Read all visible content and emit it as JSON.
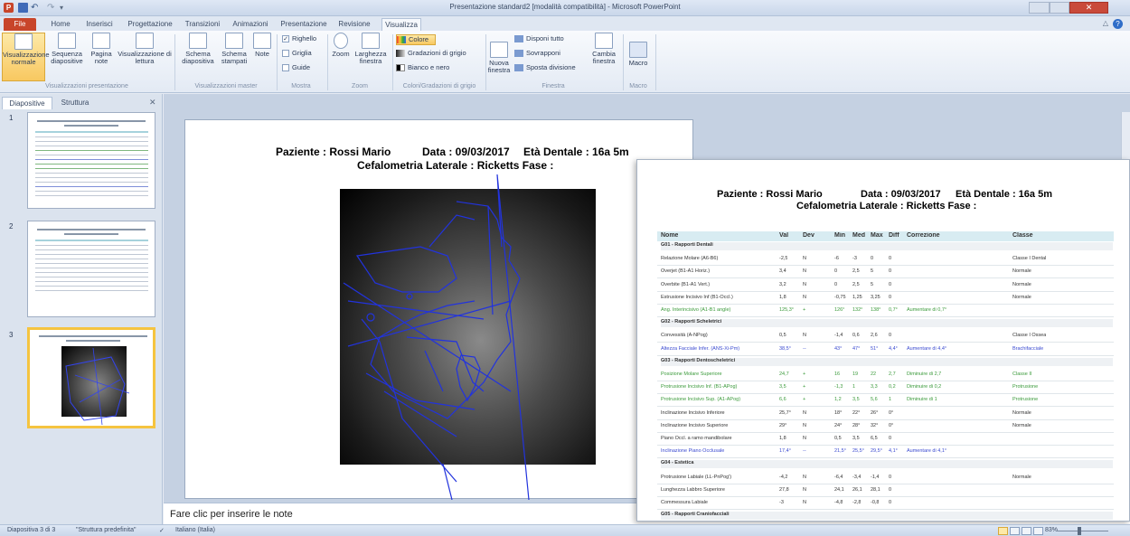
{
  "window": {
    "title": "Presentazione standard2 [modalità compatibilità] - Microsoft PowerPoint"
  },
  "tabs": [
    "File",
    "Home",
    "Inserisci",
    "Progettazione",
    "Transizioni",
    "Animazioni",
    "Presentazione",
    "Revisione",
    "Visualizza"
  ],
  "ribbon": {
    "views": {
      "normal": "Visualizzazione normale",
      "sorter": "Sequenza diapositive",
      "notes": "Pagina note",
      "reading": "Visualizzazione di lettura",
      "group": "Visualizzazioni presentazione"
    },
    "master": {
      "slide": "Schema diapositiva",
      "handout": "Schema stampati",
      "notes": "Note",
      "group": "Visualizzazioni master"
    },
    "show": {
      "ruler": "Righello",
      "grid": "Griglia",
      "guides": "Guide",
      "group": "Mostra"
    },
    "zoom": {
      "zoom": "Zoom",
      "fit": "Larghezza finestra",
      "group": "Zoom"
    },
    "color": {
      "color": "Colore",
      "gray": "Gradazioni di grigio",
      "bw": "Bianco e nero",
      "group": "Colori/Gradazioni di grigio"
    },
    "window": {
      "new": "Nuova finestra",
      "arrange": "Disponi tutto",
      "cascade": "Sovrapponi",
      "split": "Sposta divisione",
      "switch": "Cambia finestra",
      "group": "Finestra"
    },
    "macro": {
      "macro": "Macro",
      "group": "Macro"
    }
  },
  "panel": {
    "tab_slides": "Diapositive",
    "tab_outline": "Struttura",
    "slide_numbers": [
      "1",
      "2",
      "3"
    ]
  },
  "slide": {
    "patient": "Paziente : Rossi Mario",
    "date": "Data : 09/03/2017",
    "age": "Età Dentale : 16a 5m",
    "subtitle": "Cefalometria Laterale : Ricketts  Fase :"
  },
  "notes_placeholder": "Fare clic per inserire le note",
  "report": {
    "headers": [
      "Nome",
      "Val",
      "Dev",
      "Min",
      "Med",
      "Max",
      "Diff",
      "Correzione",
      "Classe"
    ],
    "rows": [
      {
        "type": "section",
        "cells": [
          "G01 - Rapporti Dentali"
        ]
      },
      {
        "type": "row",
        "color": "#333333",
        "cells": [
          "Relazione Molare (A6-B6)",
          "-2,5",
          "N",
          "-6",
          "-3",
          "0",
          "0",
          "",
          "Classe I Dental"
        ]
      },
      {
        "type": "row",
        "color": "#333333",
        "cells": [
          "Overjet (B1-A1 Horiz.)",
          "3,4",
          "N",
          "0",
          "2,5",
          "5",
          "0",
          "",
          "Normale"
        ]
      },
      {
        "type": "row",
        "color": "#333333",
        "cells": [
          "Overbite (B1-A1 Vert.)",
          "3,2",
          "N",
          "0",
          "2,5",
          "5",
          "0",
          "",
          "Normale"
        ]
      },
      {
        "type": "row",
        "color": "#333333",
        "cells": [
          "Estrusione Incisivo Inf (B1-Occl.)",
          "1,8",
          "N",
          "-0,75",
          "1,25",
          "3,25",
          "0",
          "",
          "Normale"
        ]
      },
      {
        "type": "row",
        "color": "#3a9a3a",
        "cells": [
          "Ang. Interincisivo (A1-B1 angle)",
          "125,3°",
          "+",
          "126°",
          "132°",
          "138°",
          "0,7°",
          "Aumentare di 0,7°",
          ""
        ]
      },
      {
        "type": "section",
        "cells": [
          "G02 - Rapporti Scheletrici"
        ]
      },
      {
        "type": "row",
        "color": "#333333",
        "cells": [
          "Convessità (A-NPog)",
          "0,5",
          "N",
          "-1,4",
          "0,6",
          "2,6",
          "0",
          "",
          "Classe I Ossea"
        ]
      },
      {
        "type": "row",
        "color": "#3a4ad0",
        "cells": [
          "Altezza Facciale Infer. (ANS-Xi-Pm)",
          "38,5°",
          "--",
          "43°",
          "47°",
          "51°",
          "4,4°",
          "Aumentare di 4,4°",
          "Brachifacciale"
        ]
      },
      {
        "type": "section",
        "cells": [
          "G03 - Rapporti Dentoscheletrici"
        ]
      },
      {
        "type": "row",
        "color": "#3a9a3a",
        "cells": [
          "Posizione Molare Superiore",
          "24,7",
          "+",
          "16",
          "19",
          "22",
          "2,7",
          "Diminuire di 2,7",
          "Classe II"
        ]
      },
      {
        "type": "row",
        "color": "#3a9a3a",
        "cells": [
          "Protrusione Incisivo Inf. (B1-APog)",
          "3,5",
          "+",
          "-1,3",
          "1",
          "3,3",
          "0,2",
          "Diminuire di 0,2",
          "Protrusione"
        ]
      },
      {
        "type": "row",
        "color": "#3a9a3a",
        "cells": [
          "Protrusione Incisivo Sup. (A1-APog)",
          "6,6",
          "+",
          "1,2",
          "3,5",
          "5,6",
          "1",
          "Diminuire di 1",
          "Protrusione"
        ]
      },
      {
        "type": "row",
        "color": "#333333",
        "cells": [
          "Inclinazione Incisivo Inferiore",
          "25,7°",
          "N",
          "18°",
          "22°",
          "26°",
          "0°",
          "",
          "Normale"
        ]
      },
      {
        "type": "row",
        "color": "#333333",
        "cells": [
          "Inclinazione Incisivo Superiore",
          "29°",
          "N",
          "24°",
          "28°",
          "32°",
          "0°",
          "",
          "Normale"
        ]
      },
      {
        "type": "row",
        "color": "#333333",
        "cells": [
          "Piano Occl. a ramo mandibolare",
          "1,8",
          "N",
          "0,5",
          "3,5",
          "6,5",
          "0",
          "",
          ""
        ]
      },
      {
        "type": "row",
        "color": "#3a4ad0",
        "cells": [
          "Inclinazione Piano Occlusale",
          "17,4°",
          "--",
          "21,5°",
          "25,5°",
          "29,5°",
          "4,1°",
          "Aumentare di 4,1°",
          ""
        ]
      },
      {
        "type": "section",
        "cells": [
          "G04 - Estetica"
        ]
      },
      {
        "type": "row",
        "color": "#333333",
        "cells": [
          "Protrusione Labiale (LL-PnPog')",
          "-4,2",
          "N",
          "-6,4",
          "-3,4",
          "-1,4",
          "0",
          "",
          "Normale"
        ]
      },
      {
        "type": "row",
        "color": "#333333",
        "cells": [
          "Lunghezza Labbro Superiore",
          "27,8",
          "N",
          "24,1",
          "26,1",
          "28,1",
          "0",
          "",
          ""
        ]
      },
      {
        "type": "row",
        "color": "#333333",
        "cells": [
          "Commessura Labiale",
          "-3",
          "N",
          "-4,8",
          "-2,8",
          "-0,8",
          "0",
          "",
          ""
        ]
      },
      {
        "type": "section",
        "cells": [
          "G05 - Rapporti Craniofacciali"
        ]
      }
    ]
  },
  "status": {
    "slide": "Diapositiva 3 di 3",
    "theme": "\"Struttura predefinita\"",
    "lang": "Italiano (Italia)",
    "zoom": "83%"
  },
  "colors": {
    "file_tab": "#c8452a",
    "selection": "#f5c440",
    "table_header": "#d8ecf2",
    "tracing": "#2233dd"
  }
}
